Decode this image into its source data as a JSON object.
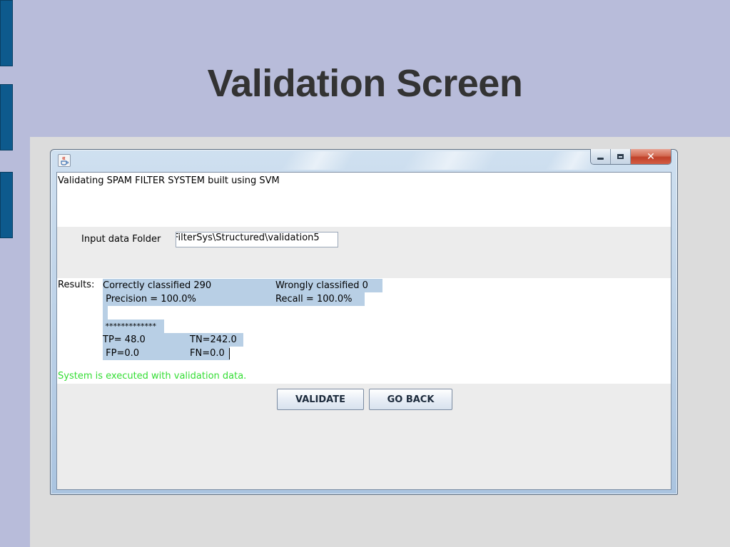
{
  "slide": {
    "title": "Validation Screen"
  },
  "window": {
    "header_text": "Validating SPAM FILTER SYSTEM built using SVM",
    "input_label": "Input data Folder",
    "input_value": "FilterSys\\Structured\\validation5",
    "results_label": "Results:",
    "results": {
      "correctly_classified": "Correctly classified 290",
      "wrongly_classified": "Wrongly classified 0",
      "precision": " Precision = 100.0%",
      "recall": "Recall = 100.0%",
      "separator": " *************",
      "tp": "TP= 48.0",
      "tn": "TN=242.0",
      "fp": " FP=0.0",
      "fn": "FN=0.0"
    },
    "status_text": "System is executed with validation data.",
    "buttons": {
      "validate": "VALIDATE",
      "go_back": "GO BACK"
    }
  },
  "colors": {
    "slide_background": "#b8bcda",
    "side_tab": "#0d5a8d",
    "selection": "#b8cfe5",
    "status_green": "#33dd33"
  },
  "icons": {
    "window_icon": "java-coffee-icon",
    "minimize": "minimize-icon",
    "maximize": "maximize-icon",
    "close": "close-icon"
  }
}
